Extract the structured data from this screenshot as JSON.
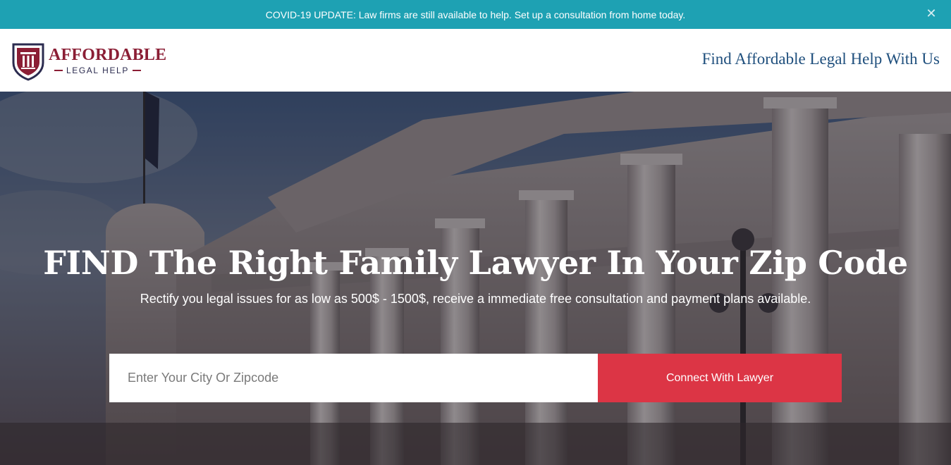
{
  "topbar": {
    "message": "COVID-19 UPDATE: Law firms are still available to help. Set up a consultation from home today.",
    "close_icon": "close-icon",
    "close_glyph": "✕"
  },
  "header": {
    "logo_title": "AFFORDABLE",
    "logo_subtitle": "LEGAL HELP",
    "logo_icon": "shield-column-icon",
    "tagline": "Find Affordable Legal Help With Us"
  },
  "hero": {
    "title": "FIND The Right Family Lawyer In Your Zip Code",
    "subtitle": "Rectify you legal issues for as low as 500$ - 1500$, receive a immediate free consultation and payment plans available.",
    "search": {
      "placeholder": "Enter Your City Or Zipcode",
      "value": ""
    },
    "button_label": "Connect With Lawyer"
  },
  "colors": {
    "topbar_bg": "#1ea1b3",
    "brand_red": "#8b1e35",
    "tagline_blue": "#1f4f7d",
    "button_red": "#dc3545"
  }
}
